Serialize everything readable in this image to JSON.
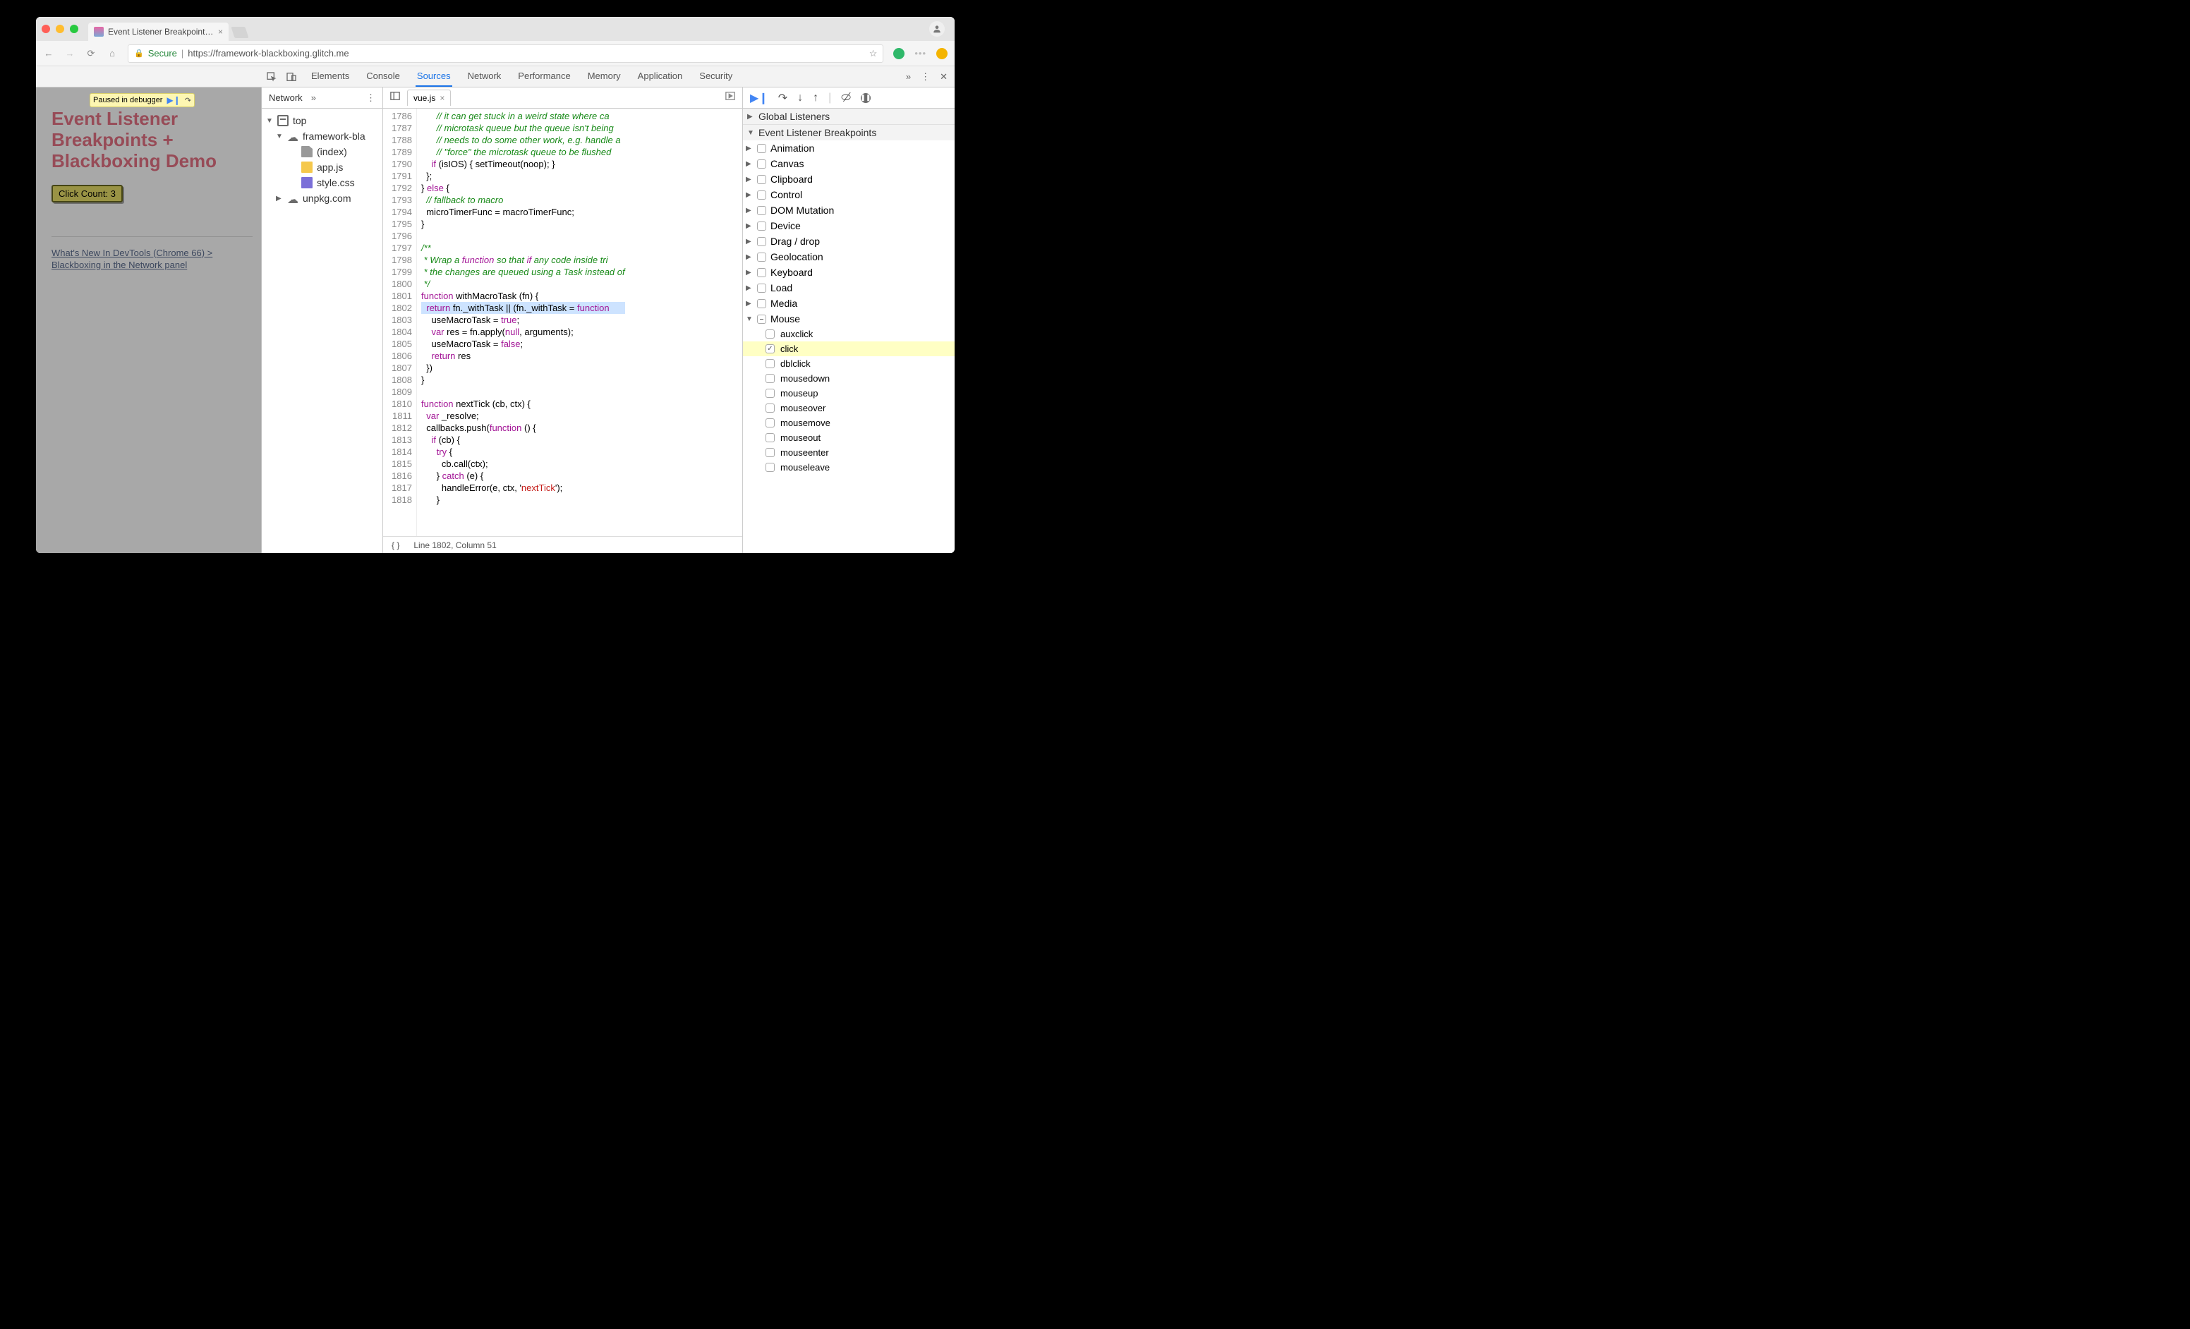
{
  "chrome": {
    "traffic": {
      "close": "#ff5f57",
      "min": "#ffbd2e",
      "max": "#28c940"
    },
    "tab_title": "Event Listener Breakpoints + B",
    "secure_label": "Secure",
    "url": "https://framework-blackboxing.glitch.me",
    "ext1": "#2fb86a",
    "ext2": "#f4b400"
  },
  "page": {
    "paused_label": "Paused in debugger",
    "heading": "Event Listener Breakpoints + Blackboxing Demo",
    "click_label": "Click Count: 3",
    "doc_link": "What's New In DevTools (Chrome 66) > Blackboxing in the Network panel"
  },
  "devtools": {
    "panels": [
      "Elements",
      "Console",
      "Sources",
      "Network",
      "Performance",
      "Memory",
      "Application",
      "Security"
    ],
    "active_panel": "Sources"
  },
  "navigator": {
    "tab": "Network",
    "top": "top",
    "domain": "framework-bla",
    "files": {
      "index": "(index)",
      "app": "app.js",
      "style": "style.css"
    },
    "cdn": "unpkg.com"
  },
  "editor": {
    "open_tab": "vue.js",
    "status": "Line 1802, Column 51",
    "first_line": 1786,
    "highlight_line": 1802,
    "lines": [
      "      // it can get stuck in a weird state where ca",
      "      // microtask queue but the queue isn't being",
      "      // needs to do some other work, e.g. handle a",
      "      // \"force\" the microtask queue to be flushed",
      "    if (isIOS) { setTimeout(noop); }",
      "  };",
      "} else {",
      "  // fallback to macro",
      "  microTimerFunc = macroTimerFunc;",
      "}",
      "",
      "/**",
      " * Wrap a function so that if any code inside tri",
      " * the changes are queued using a Task instead of",
      " */",
      "function withMacroTask (fn) {",
      "  return fn._withTask || (fn._withTask = function",
      "    useMacroTask = true;",
      "    var res = fn.apply(null, arguments);",
      "    useMacroTask = false;",
      "    return res",
      "  })",
      "} ",
      "",
      "function nextTick (cb, ctx) {",
      "  var _resolve;",
      "  callbacks.push(function () {",
      "    if (cb) {",
      "      try {",
      "        cb.call(ctx);",
      "      } catch (e) {",
      "        handleError(e, ctx, 'nextTick');",
      "      }"
    ]
  },
  "debugger": {
    "sections": {
      "global": "Global Listeners",
      "elb": "Event Listener Breakpoints"
    },
    "cats_before": [
      "Animation",
      "Canvas",
      "Clipboard",
      "Control",
      "DOM Mutation",
      "Device",
      "Drag / drop",
      "Geolocation",
      "Keyboard",
      "Load",
      "Media"
    ],
    "mouse": {
      "label": "Mouse",
      "events": [
        "auxclick",
        "click",
        "dblclick",
        "mousedown",
        "mouseup",
        "mouseover",
        "mousemove",
        "mouseout",
        "mouseenter",
        "mouseleave"
      ],
      "checked": "click"
    }
  }
}
